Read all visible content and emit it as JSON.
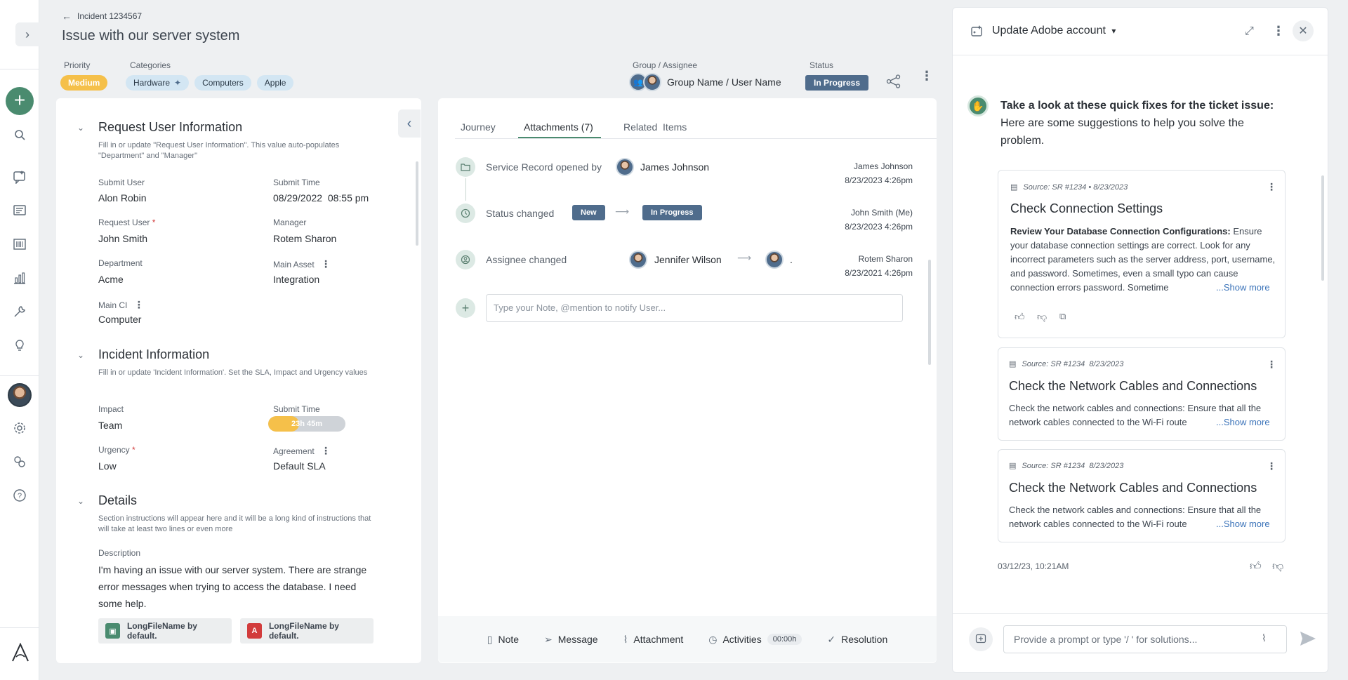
{
  "header": {
    "incident_id": "Incident 1234567",
    "title": "Issue with our server system",
    "priority_label": "Priority",
    "priority_value": "Medium",
    "categories_label": "Categories",
    "categories": [
      "Hardware",
      "Computers",
      "Apple"
    ],
    "group_label": "Group / Assignee",
    "group_value": "Group Name / User Name",
    "status_label": "Status",
    "status_value": "In Progress"
  },
  "request": {
    "title": "Request User Information",
    "desc": "Fill in or update \"Request User Information\". This value auto-populates \"Department\" and \"Manager\"",
    "submit_user_label": "Submit User",
    "submit_user": "Alon Robin",
    "submit_time_label": "Submit Time",
    "submit_time": "08/29/2022  08:55 pm",
    "request_user_label": "Request User",
    "request_user": "John Smith",
    "manager_label": "Manager",
    "manager": "Rotem Sharon",
    "department_label": "Department",
    "department": "Acme",
    "main_asset_label": "Main Asset",
    "main_asset": "Integration",
    "main_ci_label": "Main CI",
    "main_ci": "Computer"
  },
  "incident": {
    "title": "Incident Information",
    "desc": "Fill in or update 'Incident Information'. Set the SLA, Impact and Urgency values",
    "impact_label": "Impact",
    "impact": "Team",
    "submit_time_label": "Submit Time",
    "timer": "23h 45m",
    "timer_progress": 0.4,
    "urgency_label": "Urgency",
    "urgency": "Low",
    "agreement_label": "Agreement",
    "agreement": "Default SLA"
  },
  "details": {
    "title": "Details",
    "desc": "Section instructions will appear here and it will be a long kind of instructions that will take at least two lines or even more",
    "description_label": "Description",
    "description": "I'm having an issue with our server system. There are strange error messages when trying to access the database. I need some help.",
    "files": [
      "LongFileName by default.",
      "LongFileName by default."
    ]
  },
  "middle": {
    "tabs": [
      "Journey",
      "Attachments (7)",
      "Related  Items"
    ],
    "events": [
      {
        "text": "Service Record opened by",
        "name": "James Johnson",
        "meta_name": "James Johnson",
        "meta_time": "8/23/2023 4:26pm"
      },
      {
        "text": "Status changed",
        "from": "New",
        "to": "In Progress",
        "meta_name": "John Smith (Me)",
        "meta_time": "8/23/2023 4:26pm"
      },
      {
        "text": "Assignee changed",
        "name": "Jennifer Wilson",
        "to_name": ".",
        "meta_name": "Rotem Sharon",
        "meta_time": "8/23/2021 4:26pm"
      }
    ],
    "note_placeholder": "Type your Note, @mention to notify User...",
    "toolbar": {
      "note": "Note",
      "message": "Message",
      "attachment": "Attachment",
      "activities": "Activities",
      "activities_time": "00:00h",
      "resolution": "Resolution"
    }
  },
  "assistant": {
    "title": "Update Adobe account",
    "intro_bold": "Take a look at these quick fixes for the ticket issue:",
    "intro_rest": "Here are some suggestions to help you solve the problem.",
    "cards": [
      {
        "source": "Source: SR #1234 • 8/23/2023",
        "title": "Check Connection Settings",
        "bold": "Review Your Database Connection Configurations:",
        "body": " Ensure your database connection settings are correct. Look for any incorrect parameters such as the server address, port, username, and password. Sometimes, even a small typo can cause connection errors password. Sometime",
        "more": "...Show more"
      },
      {
        "source": "Source: SR #1234  8/23/2023",
        "title": "Check the Network Cables and Connections",
        "body": "Check the network cables and connections: Ensure that all the network cables connected to the Wi-Fi route",
        "more": "...Show more"
      },
      {
        "source": "Source: SR #1234  8/23/2023",
        "title": "Check the Network Cables and Connections",
        "body": "Check the network cables and connections: Ensure that all the network cables connected to the Wi-Fi route",
        "more": "...Show more"
      }
    ],
    "timestamp": "03/12/23, 10:21AM",
    "input_placeholder": "Provide a prompt or type '/ ' for solutions..."
  },
  "colors": {
    "accent": "#4a8b6f",
    "status": "#4f6c8c",
    "priority": "#f5c04a",
    "category": "#d3e6f3"
  }
}
